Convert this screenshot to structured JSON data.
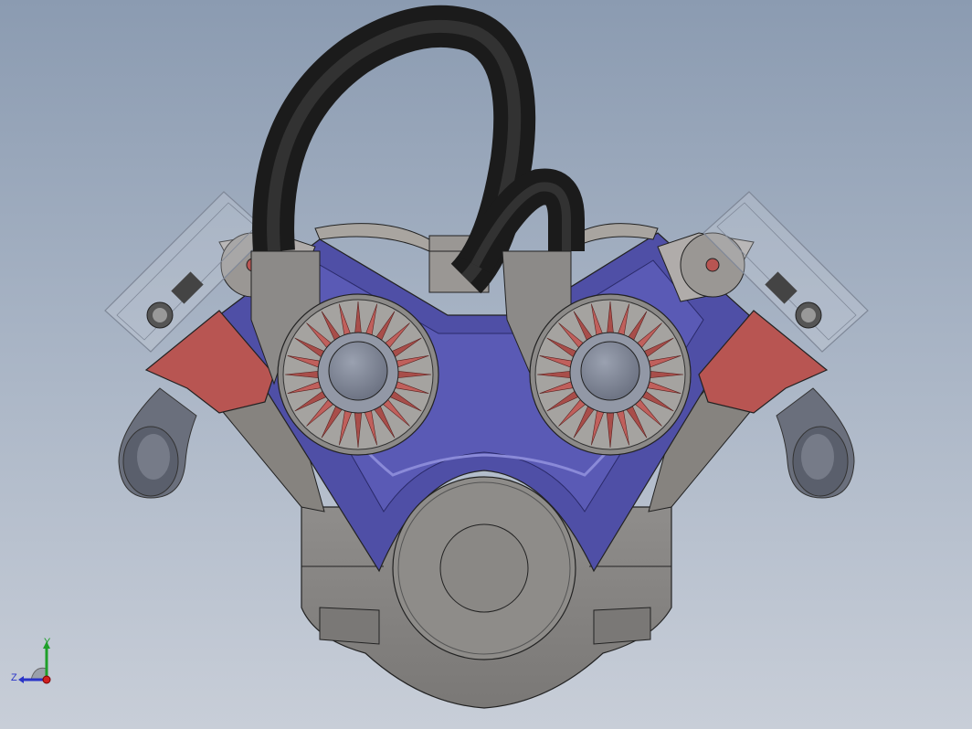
{
  "viewport": {
    "background_top": "#8b9bb1",
    "background_bottom": "#c8ced8"
  },
  "model": {
    "colors": {
      "block_grey": "#8c8a88",
      "block_dark": "#6e6c6a",
      "valley_blue": "#4f4fa6",
      "valley_light": "#6a6ac4",
      "head_red": "#b85552",
      "hose_black": "#2b2b2b",
      "fin_red": "#c0605c",
      "hub_grey": "#7e8594",
      "glass_edge": "#7f8898",
      "exhaust_blue_grey": "#6a6f7c"
    },
    "parts": [
      "engine-block",
      "valley-cover",
      "left-cylinder-head",
      "right-cylinder-head",
      "left-turbo-fan",
      "right-turbo-fan",
      "intake-hose",
      "crank-pulley",
      "left-exhaust-pipe",
      "right-exhaust-pipe",
      "left-valve-cover-glass",
      "right-valve-cover-glass"
    ]
  },
  "triad": {
    "y_label": "Y",
    "z_label": "Z",
    "colors": {
      "y": "#1fa02a",
      "z": "#2a34c8",
      "x": "#d02020"
    }
  }
}
